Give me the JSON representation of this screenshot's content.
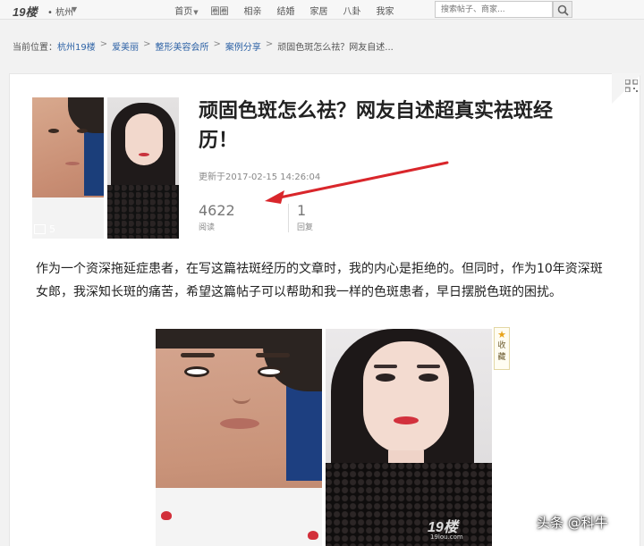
{
  "topbar": {
    "logo": "19楼",
    "city": "• 杭州",
    "nav": [
      {
        "label": "首页",
        "has_caret": true
      },
      {
        "label": "圈圈"
      },
      {
        "label": "相亲"
      },
      {
        "label": "结婚"
      },
      {
        "label": "家居"
      },
      {
        "label": "八卦"
      },
      {
        "label": "我家"
      }
    ],
    "search_placeholder": "搜索帖子、商家..."
  },
  "breadcrumb": {
    "prefix": "当前位置：",
    "items": [
      "杭州19楼",
      "爱美丽",
      "整形美容会所",
      "案例分享",
      "顽固色斑怎么祛？网友自述..."
    ],
    "separator": ">"
  },
  "post": {
    "title": "顽固色斑怎么祛？网友自述超真实祛斑经历！",
    "updated": "更新于2017-02-15 14:26:04",
    "image_count": "5",
    "views": "4622",
    "views_label": "阅读",
    "replies": "1",
    "replies_label": "回复",
    "body": "作为一个资深拖延症患者，在写这篇祛斑经历的文章时，我的内心是拒绝的。但同时，作为10年资深斑女郎，我深知长斑的痛苦，希望这篇帖子可以帮助和我一样的色斑患者，早日摆脱色斑的困扰。"
  },
  "collect": {
    "line1": "收",
    "line2": "藏"
  },
  "watermark": {
    "logo": "19楼",
    "domain": "19lou.com"
  },
  "footer": {
    "toutiao": "头条 @科牛"
  },
  "colors": {
    "link": "#2e63a6",
    "arrow": "#d9262b",
    "star": "#e8a31a"
  }
}
